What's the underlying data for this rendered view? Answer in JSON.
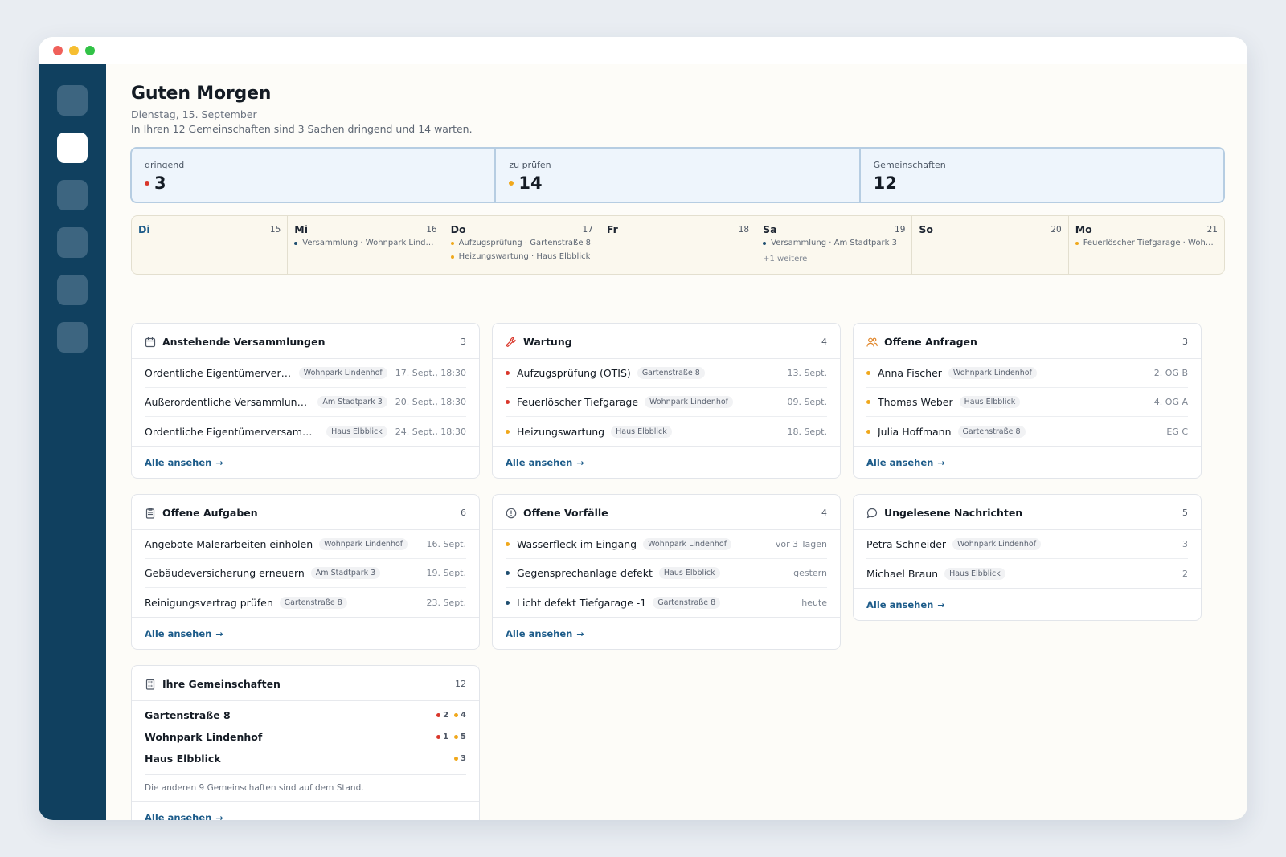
{
  "colors": {
    "urgent": "#d9372b",
    "review": "#f0a81c",
    "normal": "#1f4e70",
    "accent": "#1d5c8a",
    "sidebar": "#10405f"
  },
  "header": {
    "title": "Guten Morgen",
    "date": "Dienstag, 15. September",
    "summary": "In Ihren 12 Gemeinschaften sind 3 Sachen dringend und 14 warten."
  },
  "sidebar": {
    "items": [
      {
        "icon": "nav-icon-1"
      },
      {
        "icon": "nav-icon-2",
        "active": true
      },
      {
        "icon": "nav-icon-3"
      },
      {
        "icon": "nav-icon-4"
      },
      {
        "icon": "nav-icon-5"
      },
      {
        "icon": "nav-icon-6"
      }
    ]
  },
  "stats": [
    {
      "label": "dringend",
      "value": "3",
      "dot": "urgent"
    },
    {
      "label": "zu prüfen",
      "value": "14",
      "dot": "review"
    },
    {
      "label": "Gemeinschaften",
      "value": "12"
    }
  ],
  "week": [
    {
      "name": "Di",
      "num": "15",
      "today": true,
      "events": []
    },
    {
      "name": "Mi",
      "num": "16",
      "events": [
        {
          "text": "Versammlung · Wohnpark Lindenhof",
          "color": "normal"
        }
      ]
    },
    {
      "name": "Do",
      "num": "17",
      "events": [
        {
          "text": "Aufzugsprüfung · Gartenstraße 8",
          "color": "review"
        },
        {
          "text": "Heizungswartung · Haus Elbblick",
          "color": "review"
        }
      ]
    },
    {
      "name": "Fr",
      "num": "18",
      "events": []
    },
    {
      "name": "Sa",
      "num": "19",
      "events": [
        {
          "text": "Versammlung · Am Stadtpark 3",
          "color": "normal"
        }
      ],
      "more": "+1 weitere"
    },
    {
      "name": "So",
      "num": "20",
      "events": []
    },
    {
      "name": "Mo",
      "num": "21",
      "events": [
        {
          "text": "Feuerlöscher Tiefgarage · Wohnpark Lindenhof",
          "color": "review"
        }
      ]
    }
  ],
  "cards": {
    "versammlungen": {
      "title": "Anstehende Versammlungen",
      "count": "3",
      "link": "Alle ansehen",
      "rows": [
        {
          "title": "Ordentliche Eigentümerversammlung",
          "chip": "Wohnpark Lindenhof",
          "meta": "17. Sept., 18:30"
        },
        {
          "title": "Außerordentliche Versammlung: Dachsanierung",
          "chip": "Am Stadtpark 3",
          "meta": "20. Sept., 18:30"
        },
        {
          "title": "Ordentliche Eigentümerversammlung",
          "chip": "Haus Elbblick",
          "meta": "24. Sept., 18:30"
        }
      ]
    },
    "wartung": {
      "title": "Wartung",
      "count": "4",
      "link": "Alle ansehen",
      "rows": [
        {
          "title": "Aufzugsprüfung (OTIS)",
          "chip": "Gartenstraße 8",
          "meta": "13. Sept.",
          "dot": "urgent"
        },
        {
          "title": "Feuerlöscher Tiefgarage",
          "chip": "Wohnpark Lindenhof",
          "meta": "09. Sept.",
          "dot": "urgent"
        },
        {
          "title": "Heizungswartung",
          "chip": "Haus Elbblick",
          "meta": "18. Sept.",
          "dot": "review"
        }
      ]
    },
    "anfragen": {
      "title": "Offene Anfragen",
      "count": "3",
      "link": "Alle ansehen",
      "rows": [
        {
          "title": "Anna Fischer",
          "chip": "Wohnpark Lindenhof",
          "meta": "2. OG B",
          "dot": "review"
        },
        {
          "title": "Thomas Weber",
          "chip": "Haus Elbblick",
          "meta": "4. OG A",
          "dot": "review"
        },
        {
          "title": "Julia Hoffmann",
          "chip": "Gartenstraße 8",
          "meta": "EG C",
          "dot": "review"
        }
      ]
    },
    "aufgaben": {
      "title": "Offene Aufgaben",
      "count": "6",
      "link": "Alle ansehen",
      "rows": [
        {
          "title": "Angebote Malerarbeiten einholen",
          "chip": "Wohnpark Lindenhof",
          "meta": "16. Sept."
        },
        {
          "title": "Gebäudeversicherung erneuern",
          "chip": "Am Stadtpark 3",
          "meta": "19. Sept."
        },
        {
          "title": "Reinigungsvertrag prüfen",
          "chip": "Gartenstraße 8",
          "meta": "23. Sept."
        }
      ]
    },
    "vorfaelle": {
      "title": "Offene Vorfälle",
      "count": "4",
      "link": "Alle ansehen",
      "rows": [
        {
          "title": "Wasserfleck im Eingang",
          "chip": "Wohnpark Lindenhof",
          "meta": "vor 3 Tagen",
          "dot": "review"
        },
        {
          "title": "Gegensprechanlage defekt",
          "chip": "Haus Elbblick",
          "meta": "gestern",
          "dot": "normal"
        },
        {
          "title": "Licht defekt Tiefgarage -1",
          "chip": "Gartenstraße 8",
          "meta": "heute",
          "dot": "normal"
        }
      ]
    },
    "nachrichten": {
      "title": "Ungelesene Nachrichten",
      "count": "5",
      "link": "Alle ansehen",
      "rows": [
        {
          "title": "Petra Schneider",
          "chip": "Wohnpark Lindenhof",
          "meta": "3"
        },
        {
          "title": "Michael Braun",
          "chip": "Haus Elbblick",
          "meta": "2"
        }
      ]
    },
    "gemeinschaften": {
      "title": "Ihre Gemeinschaften",
      "count": "12",
      "link": "Alle ansehen",
      "rows": [
        {
          "name": "Gartenstraße 8",
          "urgent": "2",
          "review": "4"
        },
        {
          "name": "Wohnpark Lindenhof",
          "urgent": "1",
          "review": "5"
        },
        {
          "name": "Haus Elbblick",
          "review": "3"
        }
      ],
      "note": "Die anderen 9 Gemeinschaften sind auf dem Stand."
    }
  }
}
